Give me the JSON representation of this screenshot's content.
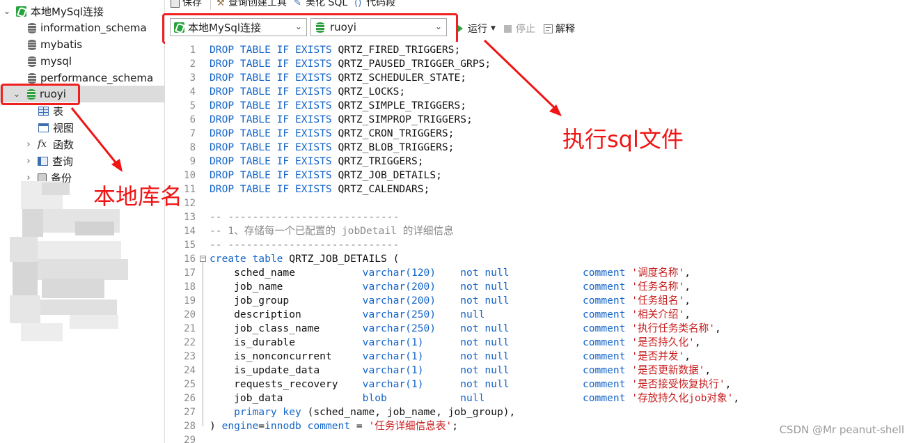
{
  "toolbar": {
    "save_label": "保存",
    "query_builder_label": "查询创建工具",
    "beautify_sql_label": "美化 SQL",
    "code_snippet_label": "代码段",
    "connection_select": "本地MySql连接",
    "database_select": "ruoyi",
    "run_label": "运行",
    "stop_label": "停止",
    "explain_label": "解释"
  },
  "navigator": {
    "connection": "本地MySql连接",
    "databases": [
      "information_schema",
      "mybatis",
      "mysql",
      "performance_schema",
      "ruoyi"
    ],
    "children": [
      "表",
      "视图",
      "函数",
      "查询",
      "备份"
    ]
  },
  "annotations": {
    "db_name_note": "本地库名",
    "run_note": "执行sql文件"
  },
  "editor": {
    "line_numbers": [
      "1",
      "2",
      "3",
      "4",
      "5",
      "6",
      "7",
      "8",
      "9",
      "10",
      "11",
      "12",
      "13",
      "14",
      "15",
      "16",
      "17",
      "18",
      "19",
      "20",
      "21",
      "22",
      "23",
      "24",
      "25",
      "26",
      "27",
      "28",
      "29"
    ],
    "drop_tables": [
      "QRTZ_FIRED_TRIGGERS",
      "QRTZ_PAUSED_TRIGGER_GRPS",
      "QRTZ_SCHEDULER_STATE",
      "QRTZ_LOCKS",
      "QRTZ_SIMPLE_TRIGGERS",
      "QRTZ_SIMPROP_TRIGGERS",
      "QRTZ_CRON_TRIGGERS",
      "QRTZ_BLOB_TRIGGERS",
      "QRTZ_TRIGGERS",
      "QRTZ_JOB_DETAILS",
      "QRTZ_CALENDARS"
    ],
    "comment_rule": "-- ----------------------------",
    "comment_text": "-- 1、存储每一个已配置的 jobDetail 的详细信息",
    "create_table": "QRTZ_JOB_DETAILS",
    "columns": [
      {
        "name": "sched_name",
        "type": "varchar(120)",
        "null": "not null",
        "comment": "'调度名称'"
      },
      {
        "name": "job_name",
        "type": "varchar(200)",
        "null": "not null",
        "comment": "'任务名称'"
      },
      {
        "name": "job_group",
        "type": "varchar(200)",
        "null": "not null",
        "comment": "'任务组名'"
      },
      {
        "name": "description",
        "type": "varchar(250)",
        "null": "null",
        "comment": "'相关介绍'"
      },
      {
        "name": "job_class_name",
        "type": "varchar(250)",
        "null": "not null",
        "comment": "'执行任务类名称'"
      },
      {
        "name": "is_durable",
        "type": "varchar(1)",
        "null": "not null",
        "comment": "'是否持久化'"
      },
      {
        "name": "is_nonconcurrent",
        "type": "varchar(1)",
        "null": "not null",
        "comment": "'是否并发'"
      },
      {
        "name": "is_update_data",
        "type": "varchar(1)",
        "null": "not null",
        "comment": "'是否更新数据'"
      },
      {
        "name": "requests_recovery",
        "type": "varchar(1)",
        "null": "not null",
        "comment": "'是否接受恢复执行'"
      },
      {
        "name": "job_data",
        "type": "blob",
        "null": "null",
        "comment": "'存放持久化job对象'"
      }
    ],
    "primary_key_cols": "(sched_name, job_name, job_group)",
    "engine": "innodb",
    "table_comment": "'任务详细信息表'"
  },
  "watermark": "CSDN @Mr peanut-shell"
}
